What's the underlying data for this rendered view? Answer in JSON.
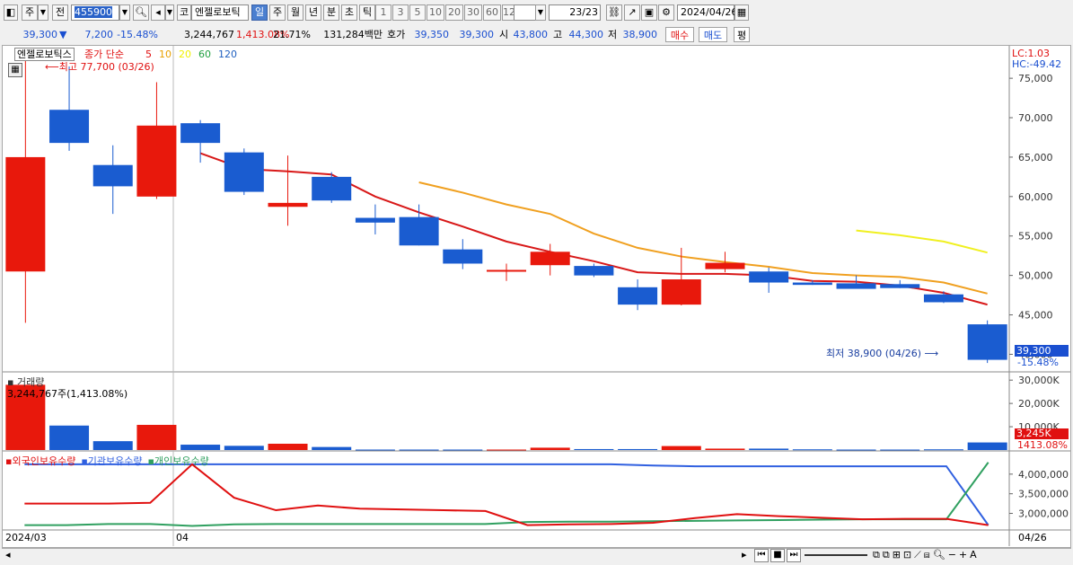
{
  "toolbar": {
    "period_btn": "주",
    "prev_btn": "전",
    "code_value": "455900",
    "market_btn": "코",
    "stock_name": "엔젤로보틱",
    "timeframes": [
      "일",
      "주",
      "월",
      "년",
      "분",
      "초",
      "틱"
    ],
    "active_timeframe": "일",
    "intervals": [
      "1",
      "3",
      "5",
      "10",
      "20",
      "30",
      "60",
      "120"
    ],
    "count": "23",
    "count_total": "/23",
    "date": "2024/04/26"
  },
  "quote": {
    "price": "39,300",
    "change_symbol": "▼",
    "change": "7,200",
    "change_rate": "-15.48%",
    "volume": "3,244,767",
    "volume_rate": "1,413.08%",
    "turnover_ratio": "21.71%",
    "amount": "131,284백만",
    "hoga_label": "호가",
    "ask": "39,350",
    "bid": "39,300",
    "open_label": "시",
    "open": "43,800",
    "high_label": "고",
    "high": "44,300",
    "low_label": "저",
    "low": "38,900",
    "buy_btn": "매수",
    "sell_btn": "매도",
    "eval_btn": "평"
  },
  "price_panel": {
    "legend_name": "엔젤로보틱스",
    "legend_ma_label": "종가 단순",
    "ma_periods": [
      "5",
      "10",
      "20",
      "60",
      "120"
    ],
    "ma_colors": [
      "#e01010",
      "#e8a000",
      "#f0f000",
      "#20a040",
      "#2060c0"
    ],
    "high_marker": "최고 77,700 (03/26)",
    "low_marker": "최저 38,900 (04/26)",
    "lc": "LC:1.03",
    "hc": "HC:-49.42",
    "last_price_tag": "39,300",
    "last_rate_tag": "-15.48%",
    "y_ticks": [
      "75,000",
      "70,000",
      "65,000",
      "60,000",
      "55,000",
      "50,000",
      "45,000",
      "40,000"
    ]
  },
  "volume_panel": {
    "title": "거래량",
    "readout": "3,244,767주(1,413.08%)",
    "y_ticks": [
      "30,000K",
      "20,000K",
      "10,000K"
    ],
    "last_tag": "3,245K",
    "last_rate": "1413.08%"
  },
  "holdings_panel": {
    "legend": [
      "외국인보유수량",
      "기관보유수량",
      "개인보유수량"
    ],
    "colors": [
      "#e01010",
      "#3060e0",
      "#30a060"
    ],
    "y_ticks": [
      "4,000,000",
      "3,500,000",
      "3,000,000"
    ]
  },
  "x_axis": {
    "labels": [
      "2024/03",
      "04"
    ],
    "right_label": "04/26"
  },
  "colors": {
    "up": "#e8180c",
    "down": "#1a5cd0",
    "accent": "#3060e0"
  },
  "chart_data": {
    "type": "candlestick",
    "dates": [
      "03/26",
      "03/27",
      "03/28",
      "03/29",
      "04/01",
      "04/02",
      "04/03",
      "04/04",
      "04/05",
      "04/08",
      "04/09",
      "04/10",
      "04/11",
      "04/12",
      "04/15",
      "04/16",
      "04/17",
      "04/18",
      "04/19",
      "04/22",
      "04/23",
      "04/24",
      "04/25",
      "04/26"
    ],
    "candles": [
      {
        "o": 50500,
        "h": 77700,
        "l": 44000,
        "c": 65000
      },
      {
        "o": 71000,
        "h": 76500,
        "l": 65800,
        "c": 66800
      },
      {
        "o": 64000,
        "h": 66500,
        "l": 57800,
        "c": 61300
      },
      {
        "o": 60000,
        "h": 74500,
        "l": 59700,
        "c": 69000
      },
      {
        "o": 69300,
        "h": 69700,
        "l": 64300,
        "c": 66800
      },
      {
        "o": 65600,
        "h": 66100,
        "l": 60200,
        "c": 60600
      },
      {
        "o": 58700,
        "h": 65200,
        "l": 56300,
        "c": 59200
      },
      {
        "o": 62500,
        "h": 63100,
        "l": 59200,
        "c": 59500
      },
      {
        "o": 57300,
        "h": 59000,
        "l": 55200,
        "c": 56700
      },
      {
        "o": 57400,
        "h": 59000,
        "l": 53800,
        "c": 53800
      },
      {
        "o": 53300,
        "h": 54600,
        "l": 50800,
        "c": 51500
      },
      {
        "o": 50700,
        "h": 51500,
        "l": 49300,
        "c": 50700
      },
      {
        "o": 51300,
        "h": 54000,
        "l": 50000,
        "c": 53000
      },
      {
        "o": 51200,
        "h": 51500,
        "l": 49800,
        "c": 50000
      },
      {
        "o": 48500,
        "h": 49500,
        "l": 45600,
        "c": 46300
      },
      {
        "o": 46300,
        "h": 53500,
        "l": 46200,
        "c": 49500
      },
      {
        "o": 50800,
        "h": 53000,
        "l": 50400,
        "c": 51600
      },
      {
        "o": 50500,
        "h": 51000,
        "l": 47800,
        "c": 49100
      },
      {
        "o": 49100,
        "h": 49400,
        "l": 48800,
        "c": 48800
      },
      {
        "o": 49000,
        "h": 50000,
        "l": 48400,
        "c": 48300
      },
      {
        "o": 48900,
        "h": 49400,
        "l": 48400,
        "c": 48400
      },
      {
        "o": 47600,
        "h": 48000,
        "l": 46500,
        "c": 46600
      },
      {
        "o": 43800,
        "h": 44300,
        "l": 38900,
        "c": 39300
      }
    ],
    "ma5": [
      null,
      null,
      null,
      null,
      65500,
      63500,
      63200,
      62800,
      60000,
      58000,
      56200,
      54300,
      53000,
      51800,
      50400,
      50200,
      50200,
      50000,
      49300,
      49200,
      48700,
      47800,
      46300
    ],
    "ma10": [
      null,
      null,
      null,
      null,
      null,
      null,
      null,
      null,
      null,
      61800,
      60500,
      59000,
      57800,
      55300,
      53500,
      52400,
      51700,
      51100,
      50300,
      50000,
      49800,
      49100,
      47700
    ],
    "ma20": [
      null,
      null,
      null,
      null,
      null,
      null,
      null,
      null,
      null,
      null,
      null,
      null,
      null,
      null,
      null,
      null,
      null,
      null,
      null,
      55700,
      55100,
      54300,
      52900
    ],
    "volume_k": [
      28000,
      10500,
      3800,
      10800,
      2300,
      1800,
      2700,
      1300,
      200,
      200,
      200,
      200,
      1000,
      400,
      400,
      1700,
      600,
      600,
      300,
      200,
      200,
      300,
      3245
    ],
    "volume_ylim": [
      0,
      32000
    ],
    "foreign": [
      3250000,
      3250000,
      3250000,
      3270000,
      4250000,
      3400000,
      3080000,
      3200000,
      3120000,
      3100000,
      3080000,
      3060000,
      2700000,
      2720000,
      2730000,
      2760000,
      2880000,
      2980000,
      2930000,
      2890000,
      2850000,
      2860000,
      2860000,
      2700000
    ],
    "institution": [
      4250000,
      4250000,
      4250000,
      4250000,
      4250000,
      4250000,
      4250000,
      4250000,
      4250000,
      4250000,
      4250000,
      4250000,
      4250000,
      4250000,
      4250000,
      4220000,
      4200000,
      4200000,
      4200000,
      4200000,
      4200000,
      4200000,
      4200000,
      2700000
    ],
    "individual": [
      2700000,
      2700000,
      2730000,
      2730000,
      2680000,
      2720000,
      2730000,
      2730000,
      2730000,
      2730000,
      2730000,
      2730000,
      2780000,
      2790000,
      2790000,
      2800000,
      2810000,
      2820000,
      2830000,
      2840000,
      2850000,
      2850000,
      2850000,
      4300000
    ],
    "price_ylim": [
      38000,
      79000
    ],
    "holdings_ylim": [
      2600000,
      4500000
    ]
  }
}
